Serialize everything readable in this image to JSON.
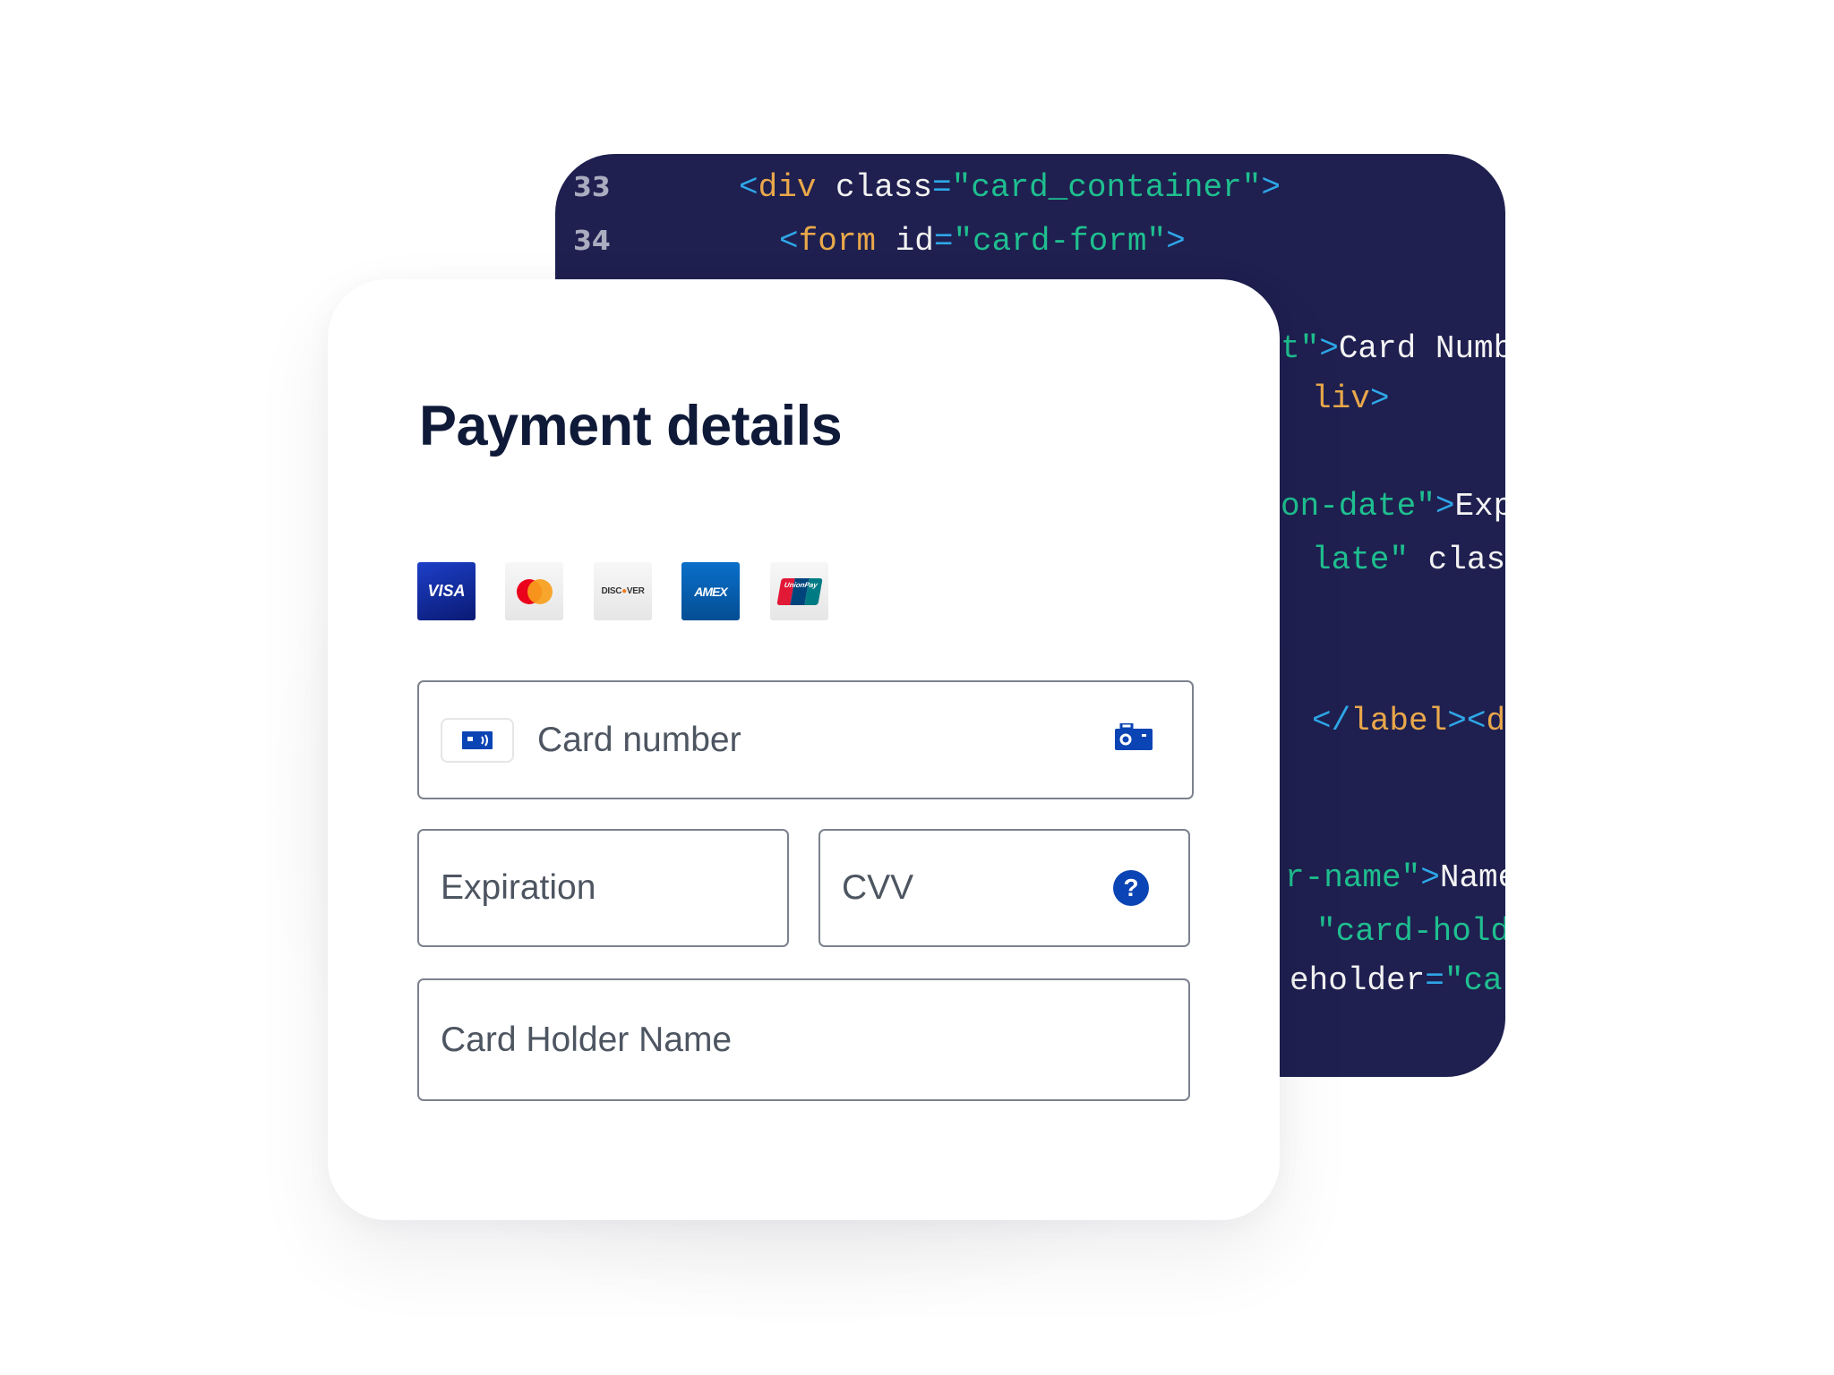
{
  "code_panel": {
    "lines": [
      {
        "num": "33",
        "tokens": [
          [
            "punct",
            "<"
          ],
          [
            "tag",
            "div"
          ],
          [
            "attr",
            " class"
          ],
          [
            "punct",
            "="
          ],
          [
            "str",
            "\"card_container\""
          ],
          [
            "punct",
            ">"
          ]
        ]
      },
      {
        "num": "34",
        "tokens": [
          [
            "punct",
            "<"
          ],
          [
            "tag",
            "form"
          ],
          [
            "attr",
            " id"
          ],
          [
            "punct",
            "="
          ],
          [
            "str",
            "\"card-form\""
          ],
          [
            "punct",
            ">"
          ]
        ]
      },
      {
        "num": "",
        "tokens": [
          [
            "str",
            "t\""
          ],
          [
            "punct",
            ">"
          ],
          [
            "text",
            "Card Numb"
          ]
        ]
      },
      {
        "num": "",
        "tokens": [
          [
            "tag",
            "liv"
          ],
          [
            "punct",
            ">"
          ]
        ]
      },
      {
        "num": "",
        "tokens": [
          [
            "str",
            "on-date\""
          ],
          [
            "punct",
            ">"
          ],
          [
            "text",
            "Exp"
          ]
        ]
      },
      {
        "num": "",
        "tokens": [
          [
            "str",
            "late\""
          ],
          [
            "attr",
            " class"
          ],
          [
            "punct",
            "="
          ]
        ]
      },
      {
        "num": "",
        "tokens": [
          [
            "punct",
            "</"
          ],
          [
            "tag",
            "label"
          ],
          [
            "punct",
            "><"
          ],
          [
            "tag",
            "div"
          ]
        ]
      },
      {
        "num": "",
        "tokens": [
          [
            "str",
            "r-name\""
          ],
          [
            "punct",
            ">"
          ],
          [
            "text",
            "Name"
          ]
        ]
      },
      {
        "num": "",
        "tokens": [
          [
            "str",
            "\"card-holder"
          ]
        ]
      },
      {
        "num": "",
        "tokens": [
          [
            "attr",
            "eholder"
          ],
          [
            "punct",
            "="
          ],
          [
            "str",
            "\"car"
          ]
        ]
      }
    ]
  },
  "card": {
    "title": "Payment details",
    "card_brands": [
      "VISA",
      "Mastercard",
      "DISCOVER",
      "AMEX",
      "UnionPay"
    ],
    "fields": {
      "card_number": {
        "placeholder": "Card number"
      },
      "expiration": {
        "placeholder": "Expiration"
      },
      "cvv": {
        "placeholder": "CVV",
        "help_icon": "?"
      },
      "card_holder": {
        "placeholder": "Card Holder Name"
      }
    }
  },
  "colors": {
    "code_bg": "#1f2050",
    "accent": "#0b44b4",
    "title": "#0f1a38",
    "placeholder": "#4d5561"
  }
}
